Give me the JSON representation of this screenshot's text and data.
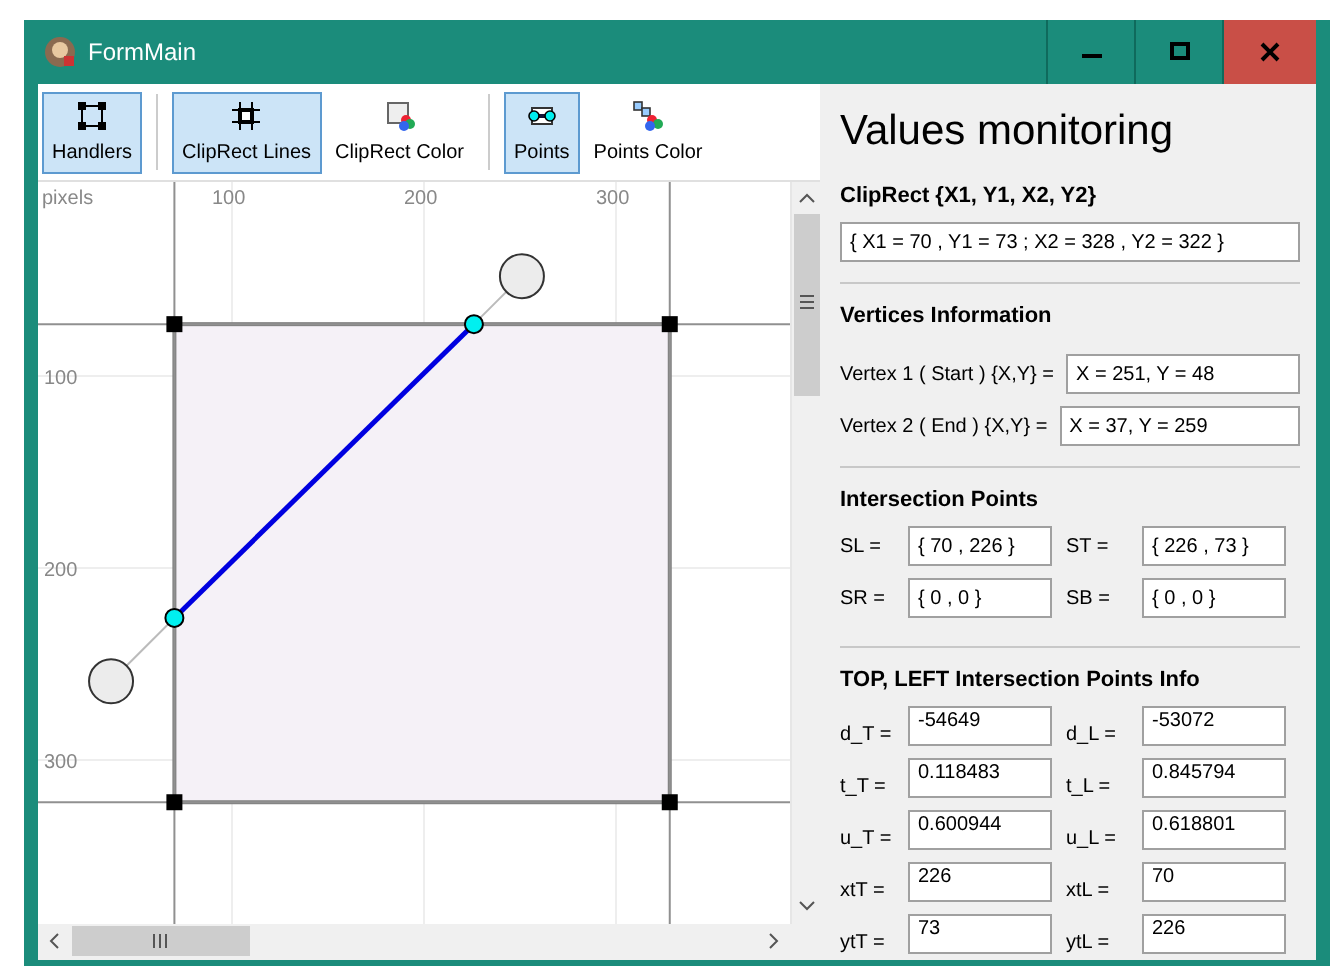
{
  "window": {
    "title": "FormMain"
  },
  "toolbar": {
    "groups": [
      [
        {
          "label": "Handlers",
          "selected": true,
          "kind": "handles"
        }
      ],
      [
        {
          "label": "ClipRect Lines",
          "selected": true,
          "kind": "lines"
        },
        {
          "label": "ClipRect Color",
          "selected": false,
          "kind": "rect-color"
        }
      ],
      [
        {
          "label": "Points",
          "selected": true,
          "kind": "points"
        },
        {
          "label": "Points Color",
          "selected": false,
          "kind": "points-color"
        }
      ]
    ]
  },
  "canvas": {
    "unit_label": "pixels",
    "x_labels": [
      "100",
      "200",
      "300"
    ],
    "y_labels": [
      "100",
      "200",
      "300"
    ]
  },
  "monitor": {
    "title": "Values monitoring",
    "clip_rect": {
      "heading": "ClipRect {X1, Y1, X2, Y2}",
      "value": "{ X1 = 70 , Y1 = 73 ; X2 = 328 , Y2 = 322 }"
    },
    "vertices": {
      "heading": "Vertices Information",
      "rows": [
        {
          "label": "Vertex 1 ( Start ) {X,Y} =",
          "value": "X = 251, Y = 48"
        },
        {
          "label": "Vertex 2 ( End ) {X,Y} =",
          "value": "X = 37, Y = 259"
        }
      ]
    },
    "intersections": {
      "heading": "Intersection Points",
      "fields": [
        {
          "label": "SL =",
          "value": "{ 70 , 226 }"
        },
        {
          "label": "ST =",
          "value": "{ 226 , 73 }"
        },
        {
          "label": "SR =",
          "value": "{ 0 , 0 }"
        },
        {
          "label": "SB =",
          "value": "{ 0 , 0 }"
        }
      ]
    },
    "info": {
      "heading": "TOP, LEFT Intersection Points Info",
      "fields": [
        {
          "label": "d_T =",
          "value": "-54649"
        },
        {
          "label": "d_L =",
          "value": "-53072"
        },
        {
          "label": "t_T =",
          "value": "0.118483"
        },
        {
          "label": "t_L =",
          "value": "0.845794"
        },
        {
          "label": "u_T =",
          "value": "0.600944"
        },
        {
          "label": "u_L =",
          "value": "0.618801"
        },
        {
          "label": "xtT =",
          "value": "226"
        },
        {
          "label": "xtL =",
          "value": "70"
        },
        {
          "label": "ytT =",
          "value": "73"
        },
        {
          "label": "ytL =",
          "value": "226"
        }
      ]
    }
  }
}
